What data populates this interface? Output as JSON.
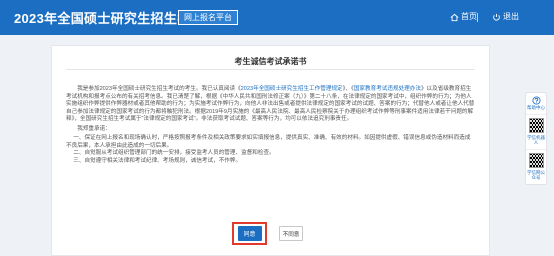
{
  "header": {
    "title": "2023年全国硕士研究生招生考试",
    "badge": "网上报名平台",
    "home_label": "首页",
    "exit_label": "退出"
  },
  "doc": {
    "title": "考生诚信考试承诺书",
    "intro_a": "我是参加2023年全国硕士研究生招生考试的考生。我已认真阅读《",
    "link1": "2023年全国硕士研究生招生工作管理规定",
    "intro_mid": "》、《",
    "link2": "国家教育考试违规处理办法",
    "intro_b": "》以及省级教育招生考试机构和报考点公布的有关招考信息。我已清楚了解，根据《中华人民共和国刑法修正案（九）》第二十八条，在法律规定的国家考试中，组织作弊的行为；为他人实施组织作弊提供作弊器材或者其他帮助的行为；为实施考试作弊行为，向他人非法出售或者提供法律规定的国家考试的试题、答案的行为；代替他人或者让他人代替自己参加法律规定的国家考试的行为都将触犯刑法。根据2019年9月实施的《最高人民法院、最高人民检察院关于办理组织考试作弊等刑事案件适用法律若干问题的解释》，全国研究生招生考试属于“法律规定的国家考试”。非法获取考试试题、答案等行为，均可以依法追究刑事责任。",
    "pledge_head": "我郑重承诺：",
    "items": [
      "一、保证在网上报名和现场确认时，严格按照报考条件及相关政策要求如实填报信息，提供真实、准确、有效的材料。如因提供虚假、错误信息或伪造材料而造成不良后果，本人承担由此造成的一切后果。",
      "二、自觉服从考试组织管理部门的统一安排，接受监考人员的管理、监督和检查。",
      "三、自觉遵守相关法律和考试纪律、考场规则，诚信考试，不作弊。"
    ],
    "agree_label": "同意",
    "disagree_label": "不同意"
  },
  "sidebar": {
    "help_label": "帮助中心",
    "robot_label": "学信机器人",
    "wechat_label": "学信网公众号"
  }
}
